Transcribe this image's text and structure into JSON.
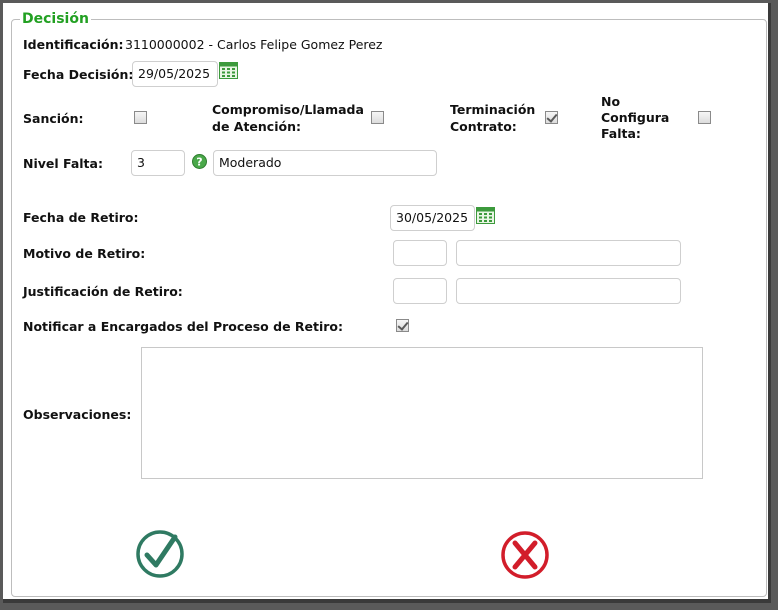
{
  "form": {
    "legend": "Decisión",
    "identificacion_label": "Identificación:",
    "identificacion_value": "3110000002 - Carlos Felipe Gomez Perez",
    "fecha_decision_label": "Fecha Decisión:",
    "fecha_decision_value": "29/05/2025",
    "sancion_label": "Sanción:",
    "sancion_checked": false,
    "compromiso_label_line1": "Compromiso/Llamada",
    "compromiso_label_line2": "de Atención:",
    "compromiso_checked": false,
    "terminacion_label_line1": "Terminación",
    "terminacion_label_line2": "Contrato:",
    "terminacion_checked": true,
    "no_configura_label_line1": "No",
    "no_configura_label_line2": "Configura",
    "no_configura_label_line3": "Falta:",
    "no_configura_checked": false,
    "nivel_falta_label": "Nivel Falta:",
    "nivel_falta_code": "3",
    "nivel_falta_desc": "Moderado",
    "fecha_retiro_label": "Fecha de Retiro:",
    "fecha_retiro_value": "30/05/2025",
    "motivo_retiro_label": "Motivo de Retiro:",
    "motivo_retiro_code": "",
    "motivo_retiro_desc": "",
    "justificacion_label": "Justificación de Retiro:",
    "justificacion_code": "",
    "justificacion_desc": "",
    "notificar_label": "Notificar a Encargados del Proceso de Retiro:",
    "notificar_checked": true,
    "observaciones_label": "Observaciones:",
    "observaciones_value": ""
  },
  "icons": {
    "calendar": "calendar-icon",
    "help": "help-icon",
    "accept": "check-circle-icon",
    "cancel": "x-circle-icon"
  },
  "colors": {
    "legend": "#22a022",
    "accept": "#2f7a62",
    "cancel": "#d21d2a",
    "calendar": "#3c9a3c"
  }
}
